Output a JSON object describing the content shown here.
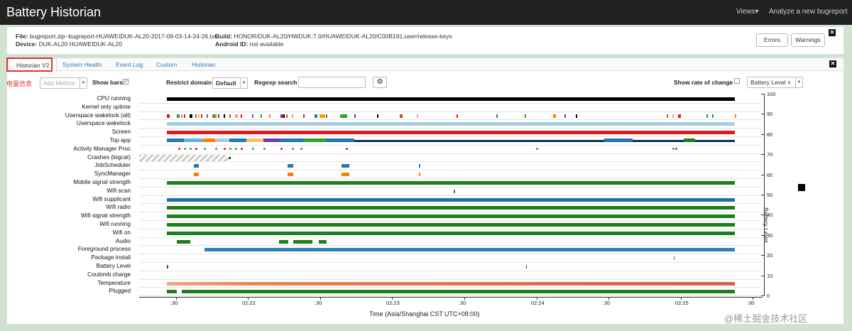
{
  "header": {
    "title": "Battery Historian",
    "nav_views": "Views▾",
    "nav_analyze": "Analyze a new bugreport"
  },
  "info": {
    "file_label": "File:",
    "file_value": "bugreport.zip~bugreport-HUAWEIDUK-AL20-2017-09-03-14-24-26.txt",
    "device_label": "Device:",
    "device_value": "DUK-AL20 HUAWEIDUK-AL20",
    "build_label": "Build:",
    "build_value": "HONOR/DUK-AL20/HWDUK:7.0/HUAWEIDUK-AL20/C00B191:user/release-keys",
    "android_label": "Android ID:",
    "android_value": "not available",
    "errors_button": "Errors",
    "warnings_button": "Warnings"
  },
  "tabs": [
    "Historian V2",
    "System Health",
    "Event Log",
    "Custom",
    "Historian"
  ],
  "controls": {
    "annotation": "电量信息",
    "add_metrics_placeholder": "Add Metrics",
    "show_bars_label": "Show bars",
    "restrict_domain_label": "Restrict domain",
    "restrict_domain_value": "Default",
    "regexp_label": "Regexp search",
    "regexp_value": "",
    "show_rate_label": "Show rate of change",
    "metric_selected": "Battery Level"
  },
  "rows": [
    {
      "label": "CPU running",
      "color": "#000000",
      "bars": [
        [
          0.0,
          1.0
        ]
      ]
    },
    {
      "label": "Kernel only uptime",
      "color": "#000000",
      "bars": []
    },
    {
      "label": "Userspace wakelock (all)",
      "color": "#ff9900",
      "bars": []
    },
    {
      "label": "Userspace wakelock",
      "color": "#a6cee3",
      "bars": [
        [
          0.0,
          1.0
        ]
      ]
    },
    {
      "label": "Screen",
      "color": "#e31a1c",
      "bars": [
        [
          0.0,
          1.0
        ]
      ]
    },
    {
      "label": "Top app",
      "color": "#1f78b4",
      "bars": []
    },
    {
      "label": "Activity Manager Proc",
      "color": "#33a02c",
      "bars": []
    },
    {
      "label": "Crashes (logcat)",
      "color": "#999999",
      "bars": []
    },
    {
      "label": "JobScheduler",
      "color": "#1f78b4",
      "bars": [
        [
          0.048,
          0.056
        ],
        [
          0.213,
          0.222
        ],
        [
          0.307,
          0.321
        ],
        [
          0.444,
          0.446
        ]
      ]
    },
    {
      "label": "SyncManager",
      "color": "#ff7f00",
      "bars": [
        [
          0.048,
          0.056
        ],
        [
          0.213,
          0.222
        ],
        [
          0.307,
          0.321
        ],
        [
          0.444,
          0.446
        ]
      ]
    },
    {
      "label": "Mobile signal strength",
      "color": "#1b7f1b",
      "bars": [
        [
          0.0,
          1.0
        ]
      ]
    },
    {
      "label": "Wifi scan",
      "color": "#1f78b4",
      "bars": [
        [
          0.505,
          0.507
        ]
      ]
    },
    {
      "label": "Wifi supplicant",
      "color": "#1f6fa8",
      "bars": [
        [
          0.0,
          1.0
        ]
      ]
    },
    {
      "label": "Wifi radio",
      "color": "#1b7f1b",
      "bars": [
        [
          0.0,
          1.0
        ]
      ]
    },
    {
      "label": "Wifi signal strength",
      "color": "#1b7f1b",
      "bars": [
        [
          0.0,
          1.0
        ]
      ]
    },
    {
      "label": "Wifi running",
      "color": "#1b7f1b",
      "bars": [
        [
          0.0,
          1.0
        ]
      ]
    },
    {
      "label": "Wifi on",
      "color": "#1b7f1b",
      "bars": [
        [
          0.0,
          1.0
        ]
      ]
    },
    {
      "label": "Audio",
      "color": "#1b7f1b",
      "bars": [
        [
          0.018,
          0.041
        ],
        [
          0.197,
          0.214
        ],
        [
          0.222,
          0.256
        ],
        [
          0.268,
          0.281
        ]
      ]
    },
    {
      "label": "Foreground process",
      "color": "#2f7fbd",
      "bars": [
        [
          0.066,
          1.0
        ]
      ]
    },
    {
      "label": "Package install",
      "color": "#1f78b4",
      "bars": [
        [
          0.892,
          0.894
        ]
      ]
    },
    {
      "label": "Battery Level",
      "color": "#1f4fa8",
      "bars": [
        [
          0.0,
          0.002
        ],
        [
          0.632,
          0.634
        ]
      ]
    },
    {
      "label": "Coulomb charge",
      "color": "#000000",
      "bars": []
    },
    {
      "label": "Temperature",
      "color": "#e8865a",
      "bars": [
        [
          0.0,
          1.0
        ]
      ]
    },
    {
      "label": "Plugged",
      "color": "#1b7f1b",
      "bars": [
        [
          0.0,
          0.018
        ],
        [
          0.026,
          1.0
        ]
      ]
    }
  ],
  "right_axis": {
    "title": "Battery Level",
    "ticks": [
      "100",
      "90",
      "80",
      "70",
      "60",
      "50",
      "40",
      "30",
      "20",
      "10",
      "0"
    ]
  },
  "x_axis": {
    "title": "Time (Asia/Shanghai CST UTC+08:00)",
    "ticks": [
      ":30",
      "02:22",
      ":30",
      "02:23",
      ":30",
      "02:24",
      ":30",
      "02:25",
      ":30"
    ]
  },
  "watermark": "@稀土掘金技术社区"
}
